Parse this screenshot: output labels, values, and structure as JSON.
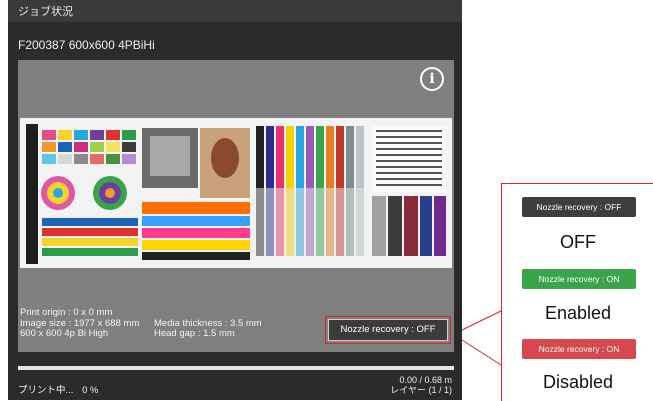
{
  "panel": {
    "title": "ジョブ状況",
    "job_name": "F200387 600x600 4PBiHi",
    "info_icon": "info-icon"
  },
  "meta": {
    "print_origin": "Print origin : 0 x 0 mm",
    "image_size": "Image size : 1977 x 688 mm",
    "media_thickness": "Media thickness : 3.5 mm",
    "resolution": "600 x 600 4p Bi High",
    "head_gap": "Head gap : 1.5 mm"
  },
  "nozzle_button": {
    "label": "Nozzle recovery : OFF"
  },
  "progress": {
    "value_fraction": 0.0,
    "status_text": "プリント中...",
    "percent_text": "0 %",
    "length_text": "0.00 / 0.68 m",
    "layer_text": "レイヤー (1 / 1)"
  },
  "legend": {
    "off": {
      "badge": "Nozzle recovery : OFF",
      "label": "OFF",
      "color": "#3e3e3e"
    },
    "on": {
      "badge": "Nozzle recovery : ON",
      "label": "Enabled",
      "color": "#3aa44b"
    },
    "disabled": {
      "badge": "Nozzle recovery : ON",
      "label": "Disabled",
      "color": "#d6484d"
    }
  },
  "colors": {
    "panel_bg": "#2b2b2b",
    "accent_red": "#d9232f",
    "progress": "#59b3e0"
  }
}
